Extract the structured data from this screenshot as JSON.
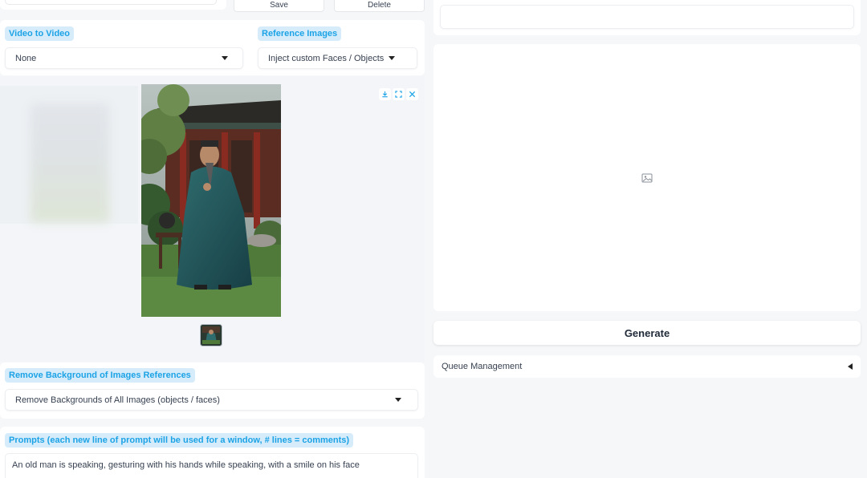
{
  "top_toolbar": {
    "save_label": "Save",
    "delete_label": "Delete"
  },
  "video_to_video": {
    "label": "Video to Video",
    "selected": "None"
  },
  "reference_images": {
    "label": "Reference Images",
    "selected": "Inject custom Faces / Objects"
  },
  "gallery": {
    "toolbar_icons": [
      "download-icon",
      "fullscreen-icon",
      "close-icon"
    ]
  },
  "remove_background": {
    "label": "Remove Background of Images References",
    "selected": "Remove Backgrounds of All Images (objects / faces)"
  },
  "prompts": {
    "label": "Prompts (each new line of prompt will be used for a window, # lines = comments)",
    "value": "An old man is speaking, gesturing with his hands while speaking, with a smile on his face"
  },
  "output": {
    "placeholder_icon": "image-icon"
  },
  "generate": {
    "label": "Generate"
  },
  "queue": {
    "label": "Queue Management"
  },
  "colors": {
    "accent": "#1ba3e6",
    "label_bg": "#d7ecfb",
    "page_bg": "#f6f7f9"
  }
}
